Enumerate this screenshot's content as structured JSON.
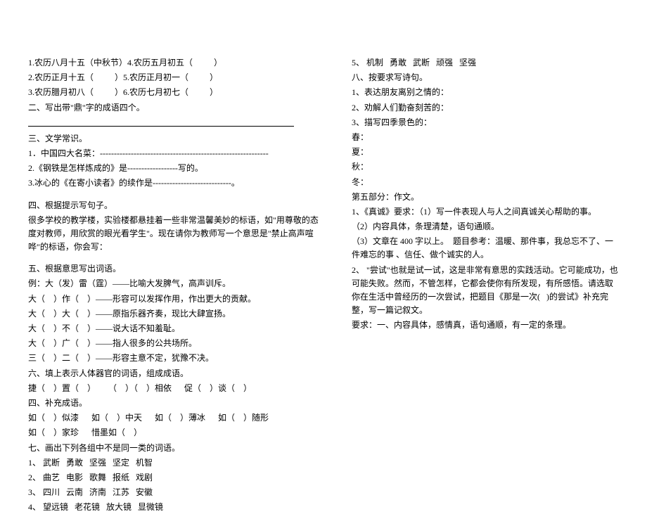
{
  "left": {
    "section1": {
      "l1": "1.农历八月十五（中秋节）4.农历五月初五（          ）",
      "l2": "2.农历正月十五（          ）5.农历正月初一（          ）",
      "l3": "3.农历腊月初八（          ）6.农历七月初七（          ）",
      "l4": "二、写出带\"鼎\"字的成语四个。"
    },
    "section3": {
      "heading": "三、文学常识。",
      "l1": "1．中国四大名菜：------------------------------------------------------------",
      "l2": "2.《钢铁是怎样炼成的》是------------------写的。",
      "l3": "3.冰心的《在寄小读者》的续作是----------------------------。"
    },
    "section4": {
      "heading": "四、根据提示写句子。",
      "p1": "很多学校的教学楼，实验楼都悬挂着一些非常温馨美妙的标语，如\"用尊敬的态度对教师，用欣赏的眼光看学生\"。现在请你为教师写一个意思是\"禁止高声喧哗\"的标语，你会写："
    },
    "section5": {
      "heading": "五、根据意思写出词语。",
      "ex": "例：大（发）雷（霆）——比喻大发脾气，高声训斥。",
      "l1": "大（    ）作（    ）——形容可以发挥作用，作出更大的贡献。",
      "l2": "大（    ）大（    ）——原指乐器齐奏，现比大肆宣扬。",
      "l3": "大（    ）不（    ）——说大话不知羞耻。",
      "l4": "大（    ）广（    ）——指人很多的公共场所。",
      "l5": "三（    ）二（    ）——形容主意不定，犹豫不决。"
    },
    "section6": {
      "heading": "六、填上表示人体器官的词语，组成成语。",
      "l1": "捷（    ）置（    ）      （    ）（    ）相依      促（    ）谈（    ）"
    },
    "section_bu": {
      "heading": "四、补充成语。",
      "l1": "如（    ）似漆      如（    ）中天      如（    ）薄冰      如（    ）随形",
      "l2": "如（    ）家珍      惜墨如（    ）"
    },
    "section7": {
      "heading": "七、画出下列各组中不是同一类的词语。",
      "l1": "1、 武断   勇敢   坚强   坚定   机智",
      "l2": "2、 曲艺   电影   歌舞   报纸   戏剧",
      "l3": "3、 四川   云南   济南   江苏   安徽",
      "l4": "4、 望远镜   老花镜   放大镜   显微镜"
    }
  },
  "right": {
    "continuation": "5、 机制   勇敢   武断   顽强   坚强",
    "section8": {
      "heading": "八、按要求写诗句。",
      "l1": "1、表达朋友离别之情的：",
      "l2": "2、劝解人们勤奋刻苦的：",
      "l3": "3、描写四季景色的：",
      "spring": "春：",
      "summer": "夏：",
      "autumn": "秋：",
      "winter": "冬："
    },
    "part5": {
      "heading": "第五部分：作文。",
      "essay1_l1": "1、《真诚》要求：（1）写一件表现人与人之间真诚关心帮助的事。",
      "essay1_l2": "（2）内容具体，条理清楚，语句通顺。",
      "essay1_l3": "（3）文章在 400 字以上。  题目参考：温暖、那件事，我总忘不了、一件难忘的事 、信任、做个诚实的人。",
      "essay2": "2、 \"尝试\"也就是试一试，这是非常有意思的实践活动。它可能成功，也可能失败。然而，不管怎样，它都会使你有所发现，有所感悟。请选取你在生活中曾经历的一次尝试，把题目《那是一次(   )的尝试》补充完整，写一篇记叙文。",
      "req": "要求：一、内容具体，感情真，语句通顺，有一定的条理。"
    }
  }
}
